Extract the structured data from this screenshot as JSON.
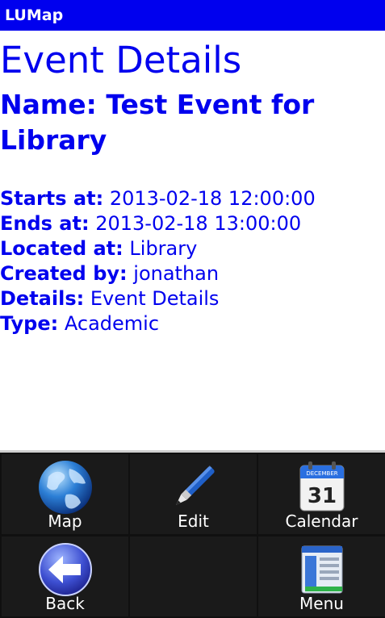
{
  "app": {
    "title": "LUMap"
  },
  "page": {
    "heading": "Event Details"
  },
  "event": {
    "name_label": "Name:",
    "name": "Test Event for Library",
    "fields": [
      {
        "label": "Starts at:",
        "value": "2013-02-18 12:00:00"
      },
      {
        "label": "Ends at:",
        "value": "2013-02-18 13:00:00"
      },
      {
        "label": "Located at:",
        "value": "Library"
      },
      {
        "label": "Created by:",
        "value": "jonathan"
      },
      {
        "label": "Details:",
        "value": "Event Details"
      },
      {
        "label": "Type:",
        "value": "Academic"
      }
    ]
  },
  "menu": {
    "items": [
      {
        "label": "Map",
        "icon": "globe-icon"
      },
      {
        "label": "Edit",
        "icon": "pen-icon"
      },
      {
        "label": "Calendar",
        "icon": "calendar-icon",
        "calendar_month": "DECEMBER",
        "calendar_day": "31"
      },
      {
        "label": "Back",
        "icon": "back-arrow-icon"
      },
      {
        "label": "",
        "icon": ""
      },
      {
        "label": "Menu",
        "icon": "menu-icon"
      }
    ]
  },
  "colors": {
    "accent": "#0000ee",
    "menu_bg": "#1a1a1a",
    "text": "#ffffff"
  }
}
